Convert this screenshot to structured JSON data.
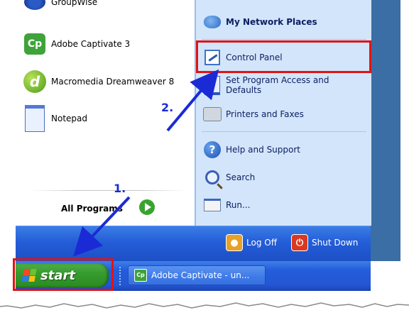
{
  "left_programs": [
    {
      "label": "GroupWise",
      "icon": "groupwise-icon"
    },
    {
      "label": "Adobe Captivate 3",
      "icon": "captivate-icon",
      "badge": "Cp"
    },
    {
      "label": "Macromedia Dreamweaver 8",
      "icon": "dreamweaver-icon",
      "badge": "d"
    },
    {
      "label": "Notepad",
      "icon": "notepad-icon"
    }
  ],
  "all_programs_label": "All Programs",
  "right_items": [
    {
      "label": "My Network Places",
      "icon": "network-places-icon"
    },
    {
      "label": "Control Panel",
      "icon": "control-panel-icon"
    },
    {
      "label": "Set Program Access and Defaults",
      "line1": "Set Program Access and",
      "line2": "Defaults",
      "icon": "set-program-access-icon"
    },
    {
      "label": "Printers and Faxes",
      "icon": "printers-faxes-icon"
    },
    {
      "label": "Help and Support",
      "icon": "help-support-icon",
      "glyph": "?"
    },
    {
      "label": "Search",
      "icon": "search-icon"
    },
    {
      "label": "Run...",
      "icon": "run-icon"
    }
  ],
  "bottom_buttons": {
    "log_off": "Log Off",
    "shut_down": "Shut Down"
  },
  "taskbar": {
    "start_label": "start",
    "task_button_label": "Adobe Captivate - un...",
    "task_icon_badge": "Cp"
  },
  "annotations": {
    "step1": "1.",
    "step2": "2.",
    "highlight_color": "#e01414",
    "arrow_color": "#1a2bd6"
  }
}
